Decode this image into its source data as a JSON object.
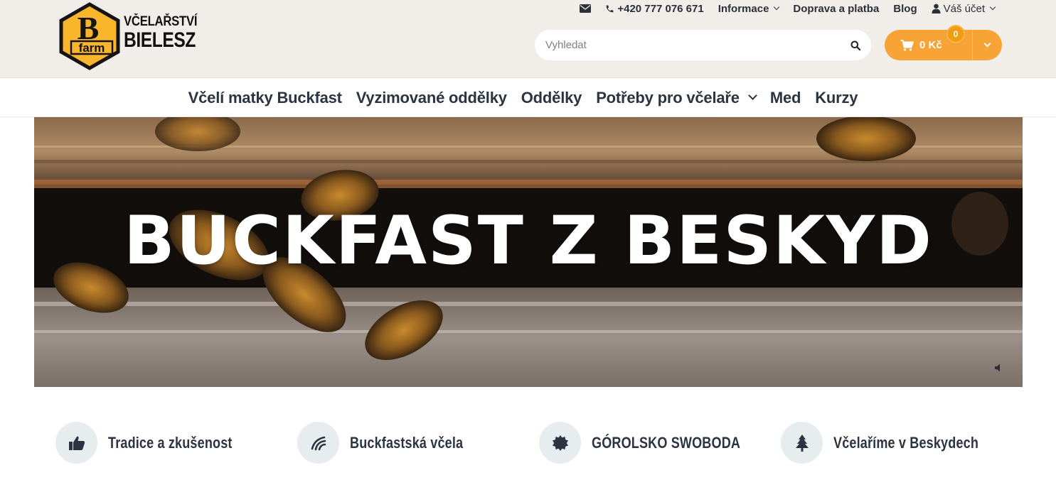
{
  "brand": {
    "logo_mark": "B farm",
    "line1": "VČELAŘSTVÍ",
    "line2": "BIELESZ",
    "colors": {
      "hex_fill": "#f9b52c",
      "hex_stroke": "#141414"
    }
  },
  "toplinks": {
    "email_icon": "envelope-icon",
    "phone": "+420 777 076 671",
    "informace": "Informace",
    "doprava": "Doprava a platba",
    "blog": "Blog",
    "account": "Váš účet"
  },
  "search": {
    "placeholder": "Vyhledat",
    "value": ""
  },
  "cart": {
    "total": "0 Kč",
    "count": "0",
    "color": "#f7a336"
  },
  "nav": {
    "items": [
      {
        "label": "Včelí matky Buckfast"
      },
      {
        "label": "Vyzimované oddělky"
      },
      {
        "label": "Oddělky"
      },
      {
        "label": "Potřeby pro včelaře",
        "has_dropdown": true
      },
      {
        "label": "Med"
      },
      {
        "label": "Kurzy"
      }
    ]
  },
  "hero": {
    "title": "BUCKFAST Z BESKYD"
  },
  "features": [
    {
      "label": "Tradice a zkušenost",
      "icon": "thumbs-up-icon"
    },
    {
      "label": "Buckfastská včela",
      "icon": "wave-lines-icon"
    },
    {
      "label": "GÓROLSKO SWOBODA",
      "icon": "sun-seal-icon"
    },
    {
      "label": "Včelaříme v Beskydech",
      "icon": "tree-icon"
    }
  ]
}
